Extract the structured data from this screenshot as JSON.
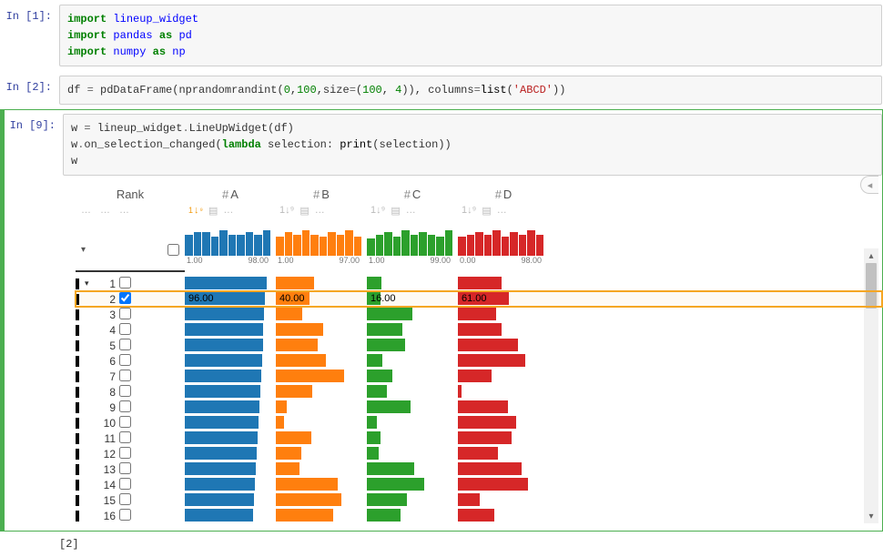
{
  "cells": {
    "c1": {
      "prompt": "In [1]:"
    },
    "c2": {
      "prompt": "In [2]:"
    },
    "c3": {
      "prompt": "In [9]:"
    },
    "out": {
      "text": "[2]"
    }
  },
  "code": {
    "c1": {
      "kw_import_1": "import",
      "mod1": "lineup_widget",
      "kw_import_2": "import",
      "mod2": "pandas",
      "kw_as_2": "as",
      "alias2": "pd",
      "kw_import_3": "import",
      "mod3": "numpy",
      "kw_as_3": "as",
      "alias3": "np"
    },
    "c2": {
      "line": "df = pd.DataFrame(np.random.randint(0,100,size=(100, 4)), columns=list('ABCD'))",
      "var_df": "df",
      "eq": " = ",
      "pd": "pd",
      ".1": ".",
      "DataFrame": "DataFrame",
      "(1": "(",
      "np": "np",
      ".2": ".",
      "random": "random",
      ".3": ".",
      "randint": "randint",
      "(2": "(",
      "n0": "0",
      ",1": ",",
      "n100": "100",
      ",2": ",",
      "size": "size",
      "=2": "=",
      "(3": "(",
      "n100b": "100",
      ",3": ", ",
      "n4": "4",
      "))": "))",
      ",4": ", ",
      "columns": "columns",
      "=3": "=",
      "list": "list",
      "(4": "(",
      "str": "'ABCD'",
      "))2": "))"
    },
    "c3": {
      "l1_w": "w",
      "l1_eq": " = ",
      "l1_lw": "lineup_widget",
      "l1_dot": ".",
      "l1_cls": "LineUpWidget",
      "l1_open": "(",
      "l1_df": "df",
      "l1_close": ")",
      "l2_w": "w",
      "l2_dot": ".",
      "l2_fn": "on_selection_changed",
      "l2_open": "(",
      "l2_lambda": "lambda",
      "l2_arg": " selection: ",
      "l2_print": "print",
      "l2_po": "(",
      "l2_sel": "selection",
      "l2_pc": ")",
      "l2_close": ")",
      "l3": "w"
    }
  },
  "headers": {
    "rank": "Rank",
    "cols": [
      {
        "name": "A",
        "label": "A"
      },
      {
        "name": "B",
        "label": "B"
      },
      {
        "name": "C",
        "label": "C"
      },
      {
        "name": "D",
        "label": "D"
      }
    ]
  },
  "hist_axis": {
    "A": {
      "min": "1.00",
      "max": "98.00"
    },
    "B": {
      "min": "1.00",
      "max": "97.00"
    },
    "C": {
      "min": "1.00",
      "max": "99.00"
    },
    "D": {
      "min": "0.00",
      "max": "98.00"
    }
  },
  "chart_data": {
    "type": "table",
    "columns": [
      "A",
      "B",
      "C",
      "D"
    ],
    "colors": {
      "A": "#1f77b4",
      "B": "#ff7f0e",
      "C": "#2ca02c",
      "D": "#d62728"
    },
    "domain": [
      0,
      100
    ],
    "histograms": {
      "A": [
        10,
        11,
        11,
        9,
        12,
        10,
        10,
        11,
        10,
        12
      ],
      "B": [
        9,
        11,
        10,
        12,
        10,
        9,
        11,
        10,
        12,
        9
      ],
      "C": [
        8,
        10,
        11,
        9,
        12,
        10,
        11,
        10,
        9,
        12
      ],
      "D": [
        9,
        10,
        11,
        10,
        12,
        9,
        11,
        10,
        12,
        10
      ]
    },
    "rows": [
      {
        "rank": 1,
        "selected": false,
        "A": 98,
        "B": 46,
        "C": 17,
        "D": 52
      },
      {
        "rank": 2,
        "selected": true,
        "A": 96,
        "B": 40,
        "C": 16,
        "D": 61
      },
      {
        "rank": 3,
        "selected": false,
        "A": 95,
        "B": 32,
        "C": 54,
        "D": 46
      },
      {
        "rank": 4,
        "selected": false,
        "A": 94,
        "B": 56,
        "C": 42,
        "D": 52
      },
      {
        "rank": 5,
        "selected": false,
        "A": 93,
        "B": 50,
        "C": 46,
        "D": 72
      },
      {
        "rank": 6,
        "selected": false,
        "A": 92,
        "B": 60,
        "C": 18,
        "D": 80
      },
      {
        "rank": 7,
        "selected": false,
        "A": 91,
        "B": 82,
        "C": 30,
        "D": 40
      },
      {
        "rank": 8,
        "selected": false,
        "A": 90,
        "B": 44,
        "C": 24,
        "D": 4
      },
      {
        "rank": 9,
        "selected": false,
        "A": 89,
        "B": 13,
        "C": 52,
        "D": 60
      },
      {
        "rank": 10,
        "selected": false,
        "A": 88,
        "B": 10,
        "C": 12,
        "D": 70
      },
      {
        "rank": 11,
        "selected": false,
        "A": 87,
        "B": 42,
        "C": 16,
        "D": 64
      },
      {
        "rank": 12,
        "selected": false,
        "A": 86,
        "B": 30,
        "C": 14,
        "D": 48
      },
      {
        "rank": 13,
        "selected": false,
        "A": 85,
        "B": 28,
        "C": 56,
        "D": 76
      },
      {
        "rank": 14,
        "selected": false,
        "A": 84,
        "B": 74,
        "C": 68,
        "D": 84
      },
      {
        "rank": 15,
        "selected": false,
        "A": 83,
        "B": 78,
        "C": 48,
        "D": 26
      },
      {
        "rank": 16,
        "selected": false,
        "A": 82,
        "B": 68,
        "C": 40,
        "D": 44
      }
    ]
  },
  "icons": {
    "dots": "…",
    "sort": "1↓⁹",
    "grid": "▤",
    "caret_down": "▾",
    "caret_left": "◂"
  }
}
